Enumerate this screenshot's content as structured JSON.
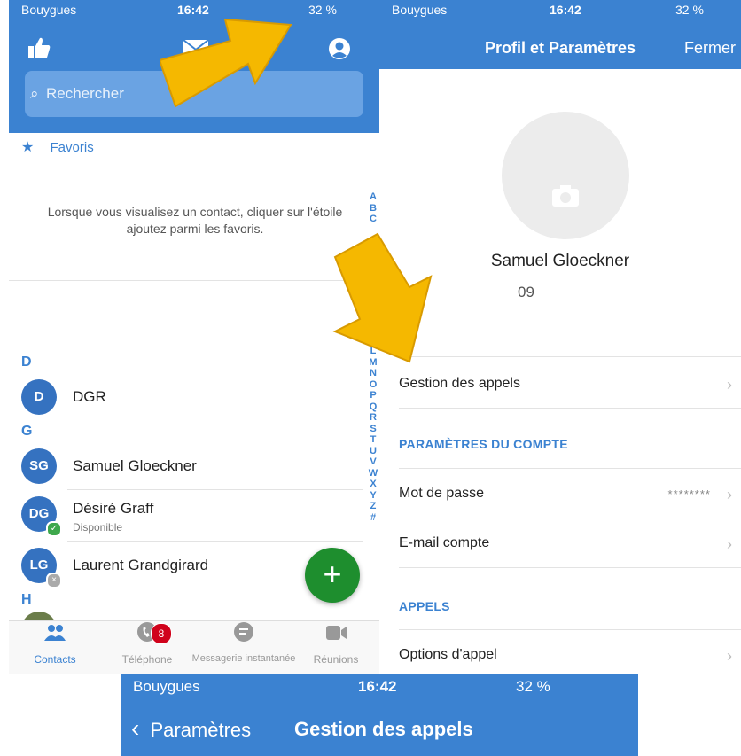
{
  "contacts_screen": {
    "status": {
      "carrier": "Bouygues",
      "time": "16:42",
      "battery": "32 %"
    },
    "search_placeholder": "Rechercher",
    "favorites": {
      "label": "Favoris",
      "empty_text": "Lorsque vous visualisez un contact, cliquer sur l'étoile ajoutez parmi les favoris."
    },
    "sections": [
      {
        "letter": "D"
      },
      {
        "letter": "G"
      },
      {
        "letter": "H"
      }
    ],
    "contacts": [
      {
        "initials": "D",
        "name": "DGR",
        "status": ""
      },
      {
        "initials": "SG",
        "name": "Samuel Gloeckner",
        "status": ""
      },
      {
        "initials": "DG",
        "name": "Désiré Graff",
        "status": "Disponible"
      },
      {
        "initials": "LG",
        "name": "Laurent Grandgirard",
        "status": ""
      }
    ],
    "alphabet_top": [
      "A",
      "B",
      "C"
    ],
    "alphabet": [
      "L",
      "M",
      "N",
      "O",
      "P",
      "Q",
      "R",
      "S",
      "T",
      "U",
      "V",
      "W",
      "X",
      "Y",
      "Z",
      "#"
    ],
    "tabs": [
      {
        "label": "Contacts",
        "icon": "contacts-icon"
      },
      {
        "label": "Téléphone",
        "icon": "phone-icon",
        "badge": "8"
      },
      {
        "label": "Messagerie instantanée",
        "icon": "chat-icon"
      },
      {
        "label": "Réunions",
        "icon": "video-icon"
      }
    ]
  },
  "profile_screen": {
    "status": {
      "carrier": "Bouygues",
      "time": "16:42",
      "battery": "32 %"
    },
    "title": "Profil et Paramètres",
    "close_label": "Fermer",
    "user_name": "Samuel Gloeckner",
    "phone": "09",
    "rows": {
      "call_management": "Gestion des appels",
      "account_section": "PARAMÈTRES DU COMPTE",
      "password": "Mot de passe",
      "password_value": "********",
      "email": "E-mail compte",
      "calls_section": "APPELS",
      "call_options": "Options d'appel"
    }
  },
  "call_management_screen": {
    "status": {
      "carrier": "Bouygues",
      "time": "16:42",
      "battery": "32 %"
    },
    "back_label": "Paramètres",
    "title": "Gestion des appels"
  },
  "colors": {
    "accent": "#3b82d1",
    "fab": "#1e8e2e",
    "arrow": "#f5b800",
    "badge": "#d0021b"
  }
}
